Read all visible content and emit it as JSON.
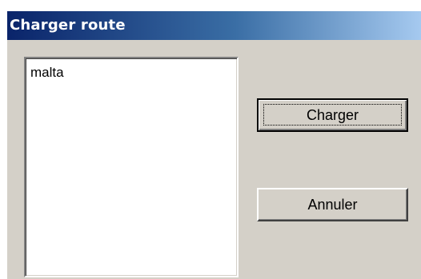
{
  "dialog": {
    "title": "Charger route"
  },
  "route_list": {
    "items": [
      "malta"
    ]
  },
  "buttons": {
    "load_label": "Charger",
    "cancel_label": "Annuler"
  },
  "colors": {
    "title_gradient_start": "#0a246a",
    "title_gradient_end": "#a6caf0",
    "dialog_face": "#d4d0c8"
  }
}
